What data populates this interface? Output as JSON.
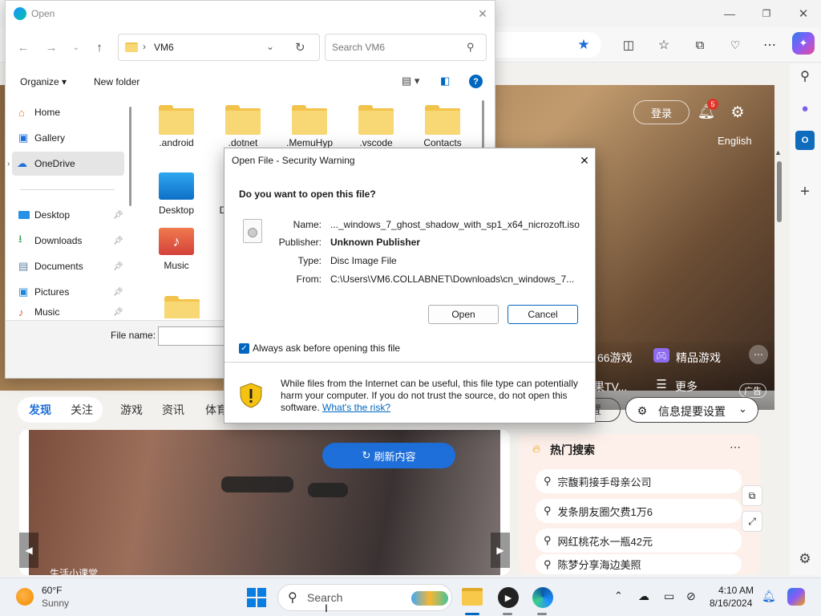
{
  "edge": {
    "hero": {
      "login_label": "登录",
      "notification_count": "5",
      "language_label": "English",
      "item_games": "66游戏",
      "item_premium_games": "精品游戏",
      "item_tv": "果TV...",
      "item_more": "更多",
      "ad_label": "广告"
    },
    "tabs": [
      "发现",
      "关注",
      "游戏",
      "资讯",
      "体育"
    ],
    "settings_partial": "置",
    "feed_settings_label": "信息提要设置",
    "refresh_label": "刷新内容",
    "news_caption": "生活小课堂",
    "hot_search": {
      "title": "热门搜索",
      "items": [
        "宗馥莉接手母亲公司",
        "发条朋友圈欠费1万6",
        "网红桃花水一瓶42元",
        "陈梦分享海边美照"
      ]
    }
  },
  "explorer": {
    "title": "Open",
    "address_folder": "VM6",
    "search_placeholder": "Search VM6",
    "organize_label": "Organize",
    "new_folder_label": "New folder",
    "nav_items": [
      {
        "label": "Home"
      },
      {
        "label": "Gallery"
      },
      {
        "label": "OneDrive"
      },
      {
        "label": "Desktop"
      },
      {
        "label": "Downloads"
      },
      {
        "label": "Documents"
      },
      {
        "label": "Pictures"
      },
      {
        "label": "Music"
      }
    ],
    "files": [
      ".android",
      ".dotnet",
      ".MemuHyp",
      ".vscode",
      "Contacts",
      "Desktop",
      "D",
      "Music"
    ],
    "file_name_label": "File name:"
  },
  "security_warning": {
    "title": "Open File - Security Warning",
    "question": "Do you want to open this file?",
    "name_label": "Name:",
    "name_value": "..._windows_7_ghost_shadow_with_sp1_x64_nicrozoft.iso",
    "publisher_label": "Publisher:",
    "publisher_value": "Unknown Publisher",
    "type_label": "Type:",
    "type_value": "Disc Image File",
    "from_label": "From:",
    "from_value": "C:\\Users\\VM6.COLLABNET\\Downloads\\cn_windows_7...",
    "open_label": "Open",
    "cancel_label": "Cancel",
    "checkbox_label": "Always ask before opening this file",
    "footer_text": "While files from the Internet can be useful, this file type can potentially harm your computer. If you do not trust the source, do not open this software. ",
    "risk_link": "What's the risk?"
  },
  "taskbar": {
    "temperature": "60°F",
    "weather": "Sunny",
    "search_placeholder": "Search",
    "time": "4:10 AM",
    "date": "8/16/2024"
  },
  "colors": {
    "accent": "#0067c0",
    "edge_blue": "#1e6fd9",
    "folder": "#f8d775"
  }
}
